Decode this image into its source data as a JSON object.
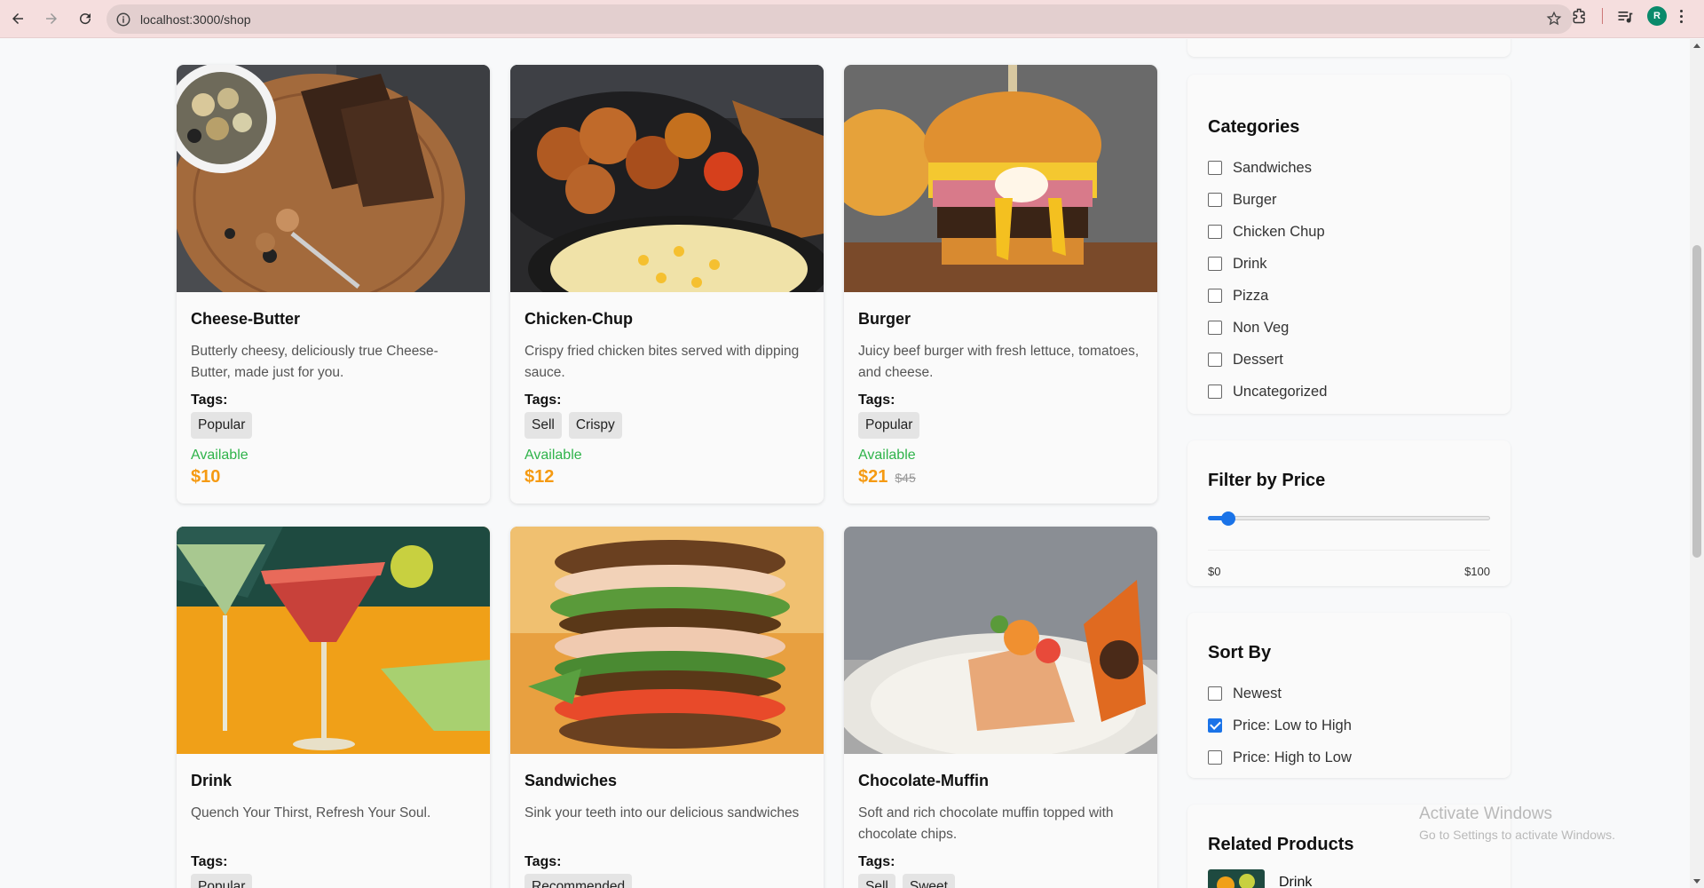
{
  "browser": {
    "url": "localhost:3000/shop",
    "avatar_initial": "R"
  },
  "products": [
    {
      "name": "Cheese-Butter",
      "description": "Butterly cheesy, deliciously true Cheese-Butter, made just for you.",
      "tags_label": "Tags:",
      "tags": [
        "Popular"
      ],
      "availability": "Available",
      "price": "$10",
      "old_price": ""
    },
    {
      "name": "Chicken-Chup",
      "description": "Crispy fried chicken bites served with dipping sauce.",
      "tags_label": "Tags:",
      "tags": [
        "Sell",
        "Crispy"
      ],
      "availability": "Available",
      "price": "$12",
      "old_price": ""
    },
    {
      "name": "Burger",
      "description": "Juicy beef burger with fresh lettuce, tomatoes, and cheese.",
      "tags_label": "Tags:",
      "tags": [
        "Popular"
      ],
      "availability": "Available",
      "price": "$21",
      "old_price": "$45"
    },
    {
      "name": "Drink",
      "description": "Quench Your Thirst, Refresh Your Soul.",
      "tags_label": "Tags:",
      "tags": [
        "Popular"
      ]
    },
    {
      "name": "Sandwiches",
      "description": "Sink your teeth into our delicious sandwiches",
      "tags_label": "Tags:",
      "tags": [
        "Recommended"
      ]
    },
    {
      "name": "Chocolate-Muffin",
      "description": "Soft and rich chocolate muffin topped with chocolate chips.",
      "tags_label": "Tags:",
      "tags": [
        "Sell",
        "Sweet"
      ]
    }
  ],
  "sidebar": {
    "categories": {
      "title": "Categories",
      "items": [
        "Sandwiches",
        "Burger",
        "Chicken Chup",
        "Drink",
        "Pizza",
        "Non Veg",
        "Dessert",
        "Uncategorized"
      ]
    },
    "price_filter": {
      "title": "Filter by Price",
      "min_label": "$0",
      "max_label": "$100",
      "value_fraction": 0.05
    },
    "sort": {
      "title": "Sort By",
      "options": [
        "Newest",
        "Price: Low to High",
        "Price: High to Low"
      ],
      "checked": [
        false,
        true,
        false
      ]
    },
    "related": {
      "title": "Related Products",
      "first_item": "Drink"
    }
  },
  "watermark": {
    "line1": "Activate Windows",
    "line2": "Go to Settings to activate Windows."
  },
  "colors": {
    "accent": "#1a73e8",
    "price": "#f59a12",
    "available": "#2fb34a"
  }
}
